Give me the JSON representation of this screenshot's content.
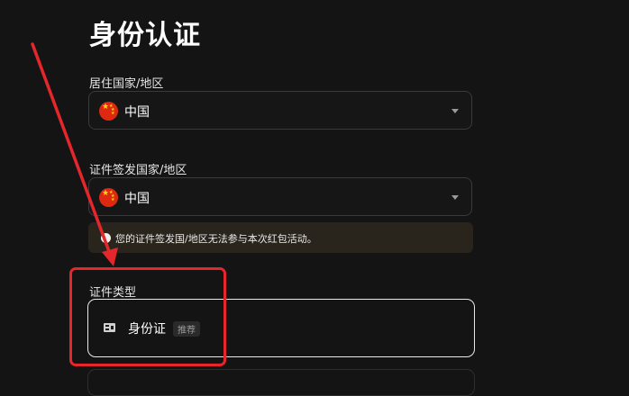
{
  "page": {
    "title": "身份认证"
  },
  "residence": {
    "label": "居住国家/地区",
    "value": "中国",
    "icon": "china-flag-icon"
  },
  "issuing": {
    "label": "证件签发国家/地区",
    "value": "中国",
    "icon": "china-flag-icon"
  },
  "warning": {
    "text": "您的证件签发国/地区无法参与本次红包活动。",
    "icon": "info-icon"
  },
  "doc_type": {
    "label": "证件类型",
    "options": [
      {
        "name": "身份证",
        "tag": "推荐",
        "icon": "id-card-icon"
      }
    ]
  },
  "colors": {
    "background": "#141414",
    "annotation": "#e5262a",
    "warning_bg": "#2a251c"
  }
}
